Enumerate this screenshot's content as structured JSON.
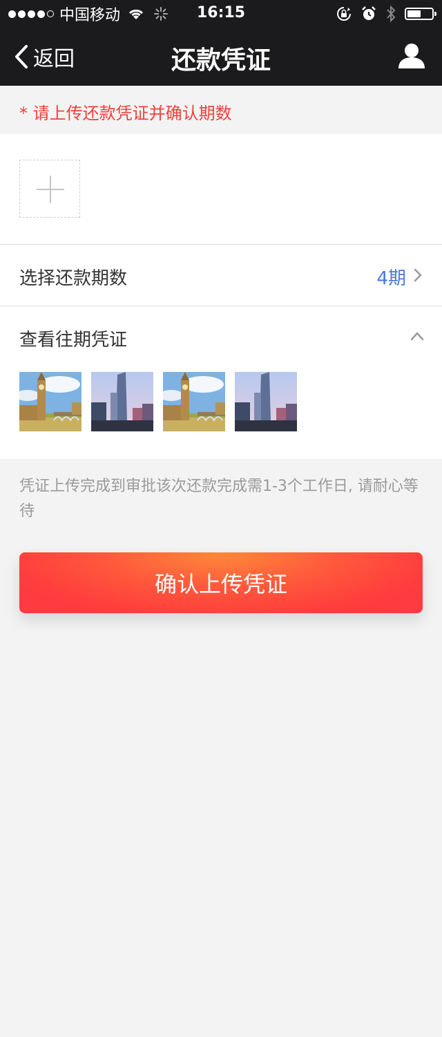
{
  "status_bar": {
    "carrier": "中国移动",
    "time": "16:15",
    "signal_icon": "signal-dots-icon",
    "wifi_icon": "wifi-icon",
    "loading_icon": "activity-spinner-icon",
    "rotation_lock_icon": "rotation-lock-icon",
    "alarm_icon": "alarm-icon",
    "bluetooth_icon": "bluetooth-icon",
    "battery_icon": "battery-icon",
    "battery_level": 0.6
  },
  "nav": {
    "back_label": "返回",
    "title": "还款凭证",
    "user_icon": "user-icon"
  },
  "notice": {
    "text": "* 请上传还款凭证并确认期数",
    "color": "#f0403a"
  },
  "upload": {
    "add_icon": "plus-icon"
  },
  "period_row": {
    "label": "选择还款期数",
    "value": "4期"
  },
  "history": {
    "label": "查看往期凭证",
    "thumbnails": [
      "big-ben-photo",
      "skyscraper-photo",
      "big-ben-photo",
      "skyscraper-photo"
    ]
  },
  "info": {
    "text": "凭证上传完成到审批该次还款完成需1-3个工作日, 请耐心等待"
  },
  "confirm": {
    "label": "确认上传凭证"
  },
  "colors": {
    "header_bg": "#1b1b1d",
    "accent_blue": "#4a79d8",
    "button_red": "#ff3d3d",
    "button_orange": "#ff8a3a"
  }
}
